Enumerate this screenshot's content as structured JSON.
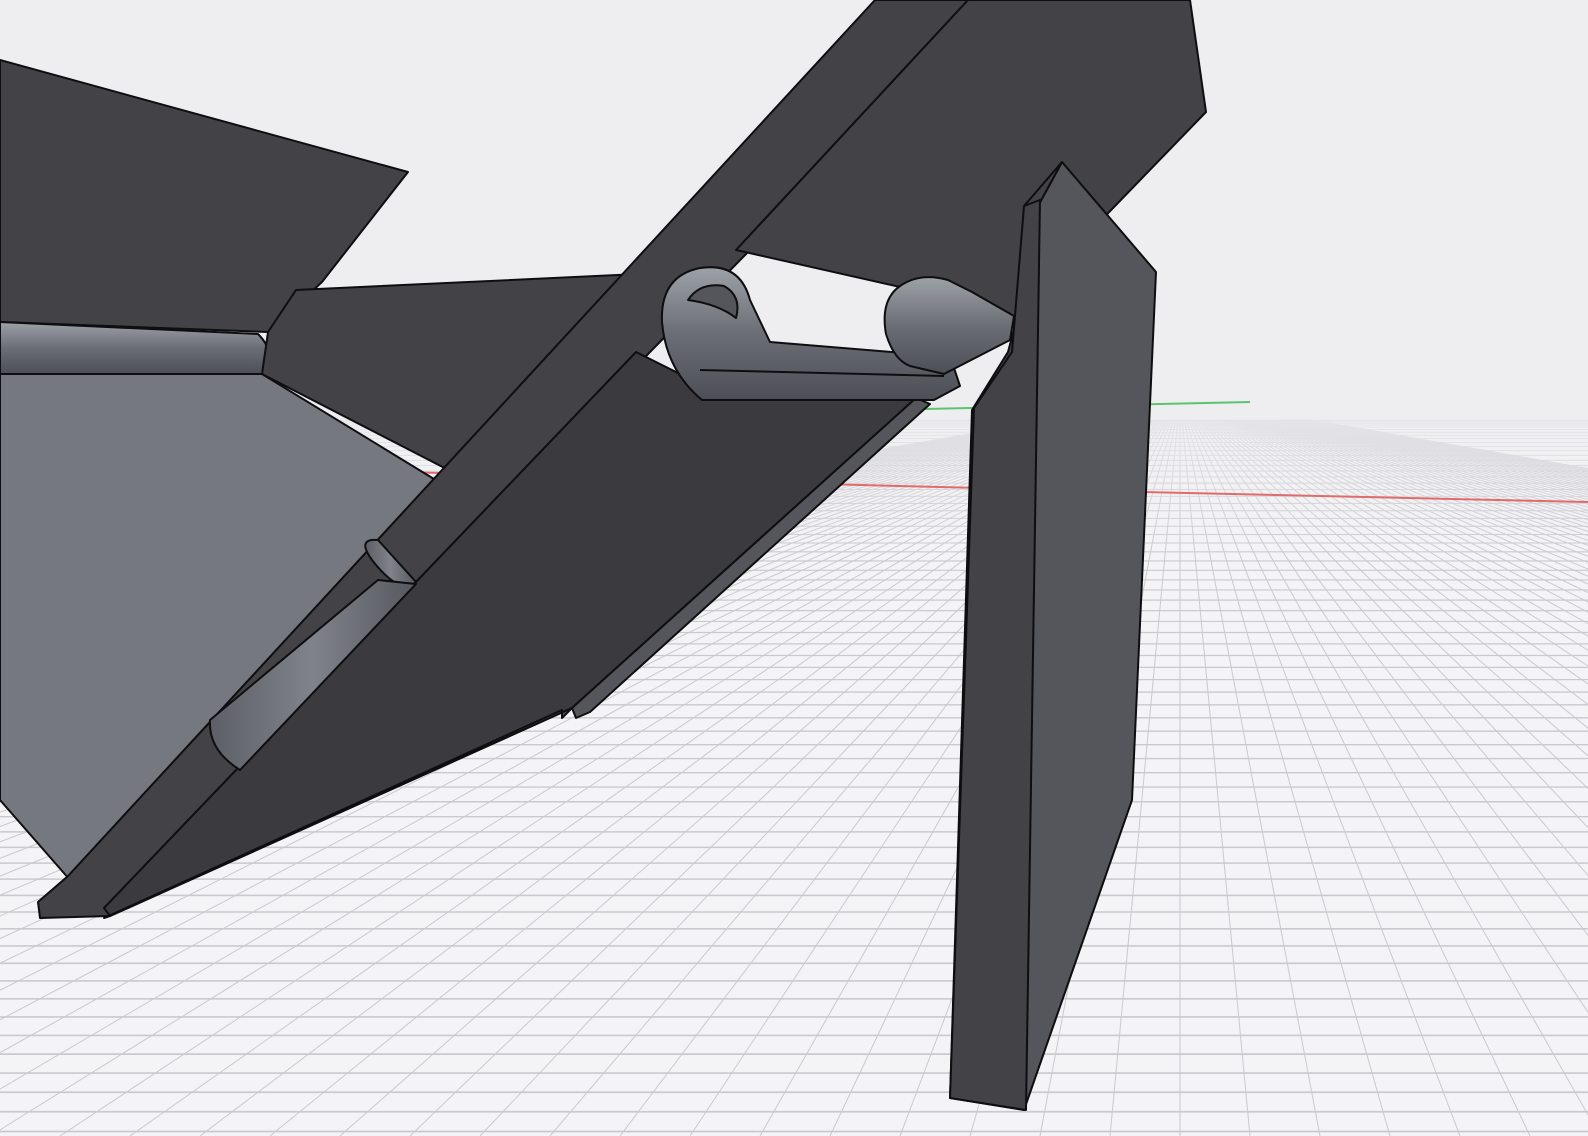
{
  "viewport": {
    "background": "#eeeef1",
    "grid": {
      "visible": true,
      "line_color": "#c9c9cf",
      "floor_color": "#f4f4f6"
    },
    "axes": [
      {
        "name": "x-axis",
        "color": "#e06b6b"
      },
      {
        "name": "y-axis",
        "color": "#5cc46e"
      }
    ]
  },
  "model": {
    "kind": "cad-hinged-bracket",
    "colors": {
      "body": "#424247",
      "body_dark": "#3a3a3f",
      "face_side": "#55565c",
      "face_light": "#75787f",
      "face_lighter": "#8a8e95",
      "hinge": "#6b6e75",
      "hinge_highlight": "#9da1a8",
      "edge": "#0e0e10"
    }
  }
}
